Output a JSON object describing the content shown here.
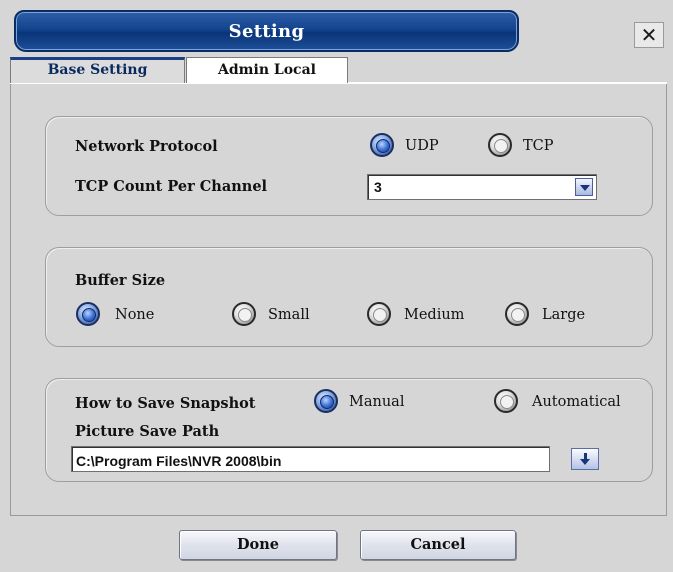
{
  "window": {
    "title": "Setting",
    "close_label": "✕"
  },
  "tabs": [
    {
      "label": "Base Setting",
      "active": true
    },
    {
      "label": "Admin Local",
      "active": false
    }
  ],
  "network": {
    "protocol_label": "Network Protocol",
    "protocol_options": [
      {
        "label": "UDP",
        "selected": true
      },
      {
        "label": "TCP",
        "selected": false
      }
    ],
    "tcp_count_label": "TCP Count Per Channel",
    "tcp_count_value": "3"
  },
  "buffer": {
    "label": "Buffer Size",
    "options": [
      {
        "label": "None",
        "selected": true
      },
      {
        "label": "Small",
        "selected": false
      },
      {
        "label": "Medium",
        "selected": false
      },
      {
        "label": "Large",
        "selected": false
      }
    ]
  },
  "snapshot": {
    "label": "How to Save Snapshot",
    "options": [
      {
        "label": "Manual",
        "selected": true
      },
      {
        "label": "Automatical",
        "selected": false
      }
    ],
    "path_label": "Picture Save Path",
    "path_value": "C:\\Program Files\\NVR 2008\\bin"
  },
  "footer": {
    "done_label": "Done",
    "cancel_label": "Cancel"
  },
  "colors": {
    "title_bar": "#15448e",
    "selected_radio": "#1c3f86",
    "dialog_bg": "#d6d6d6"
  },
  "icons": {
    "close": "close-icon",
    "dropdown": "chevron-down-icon",
    "browse": "arrow-down-icon"
  }
}
